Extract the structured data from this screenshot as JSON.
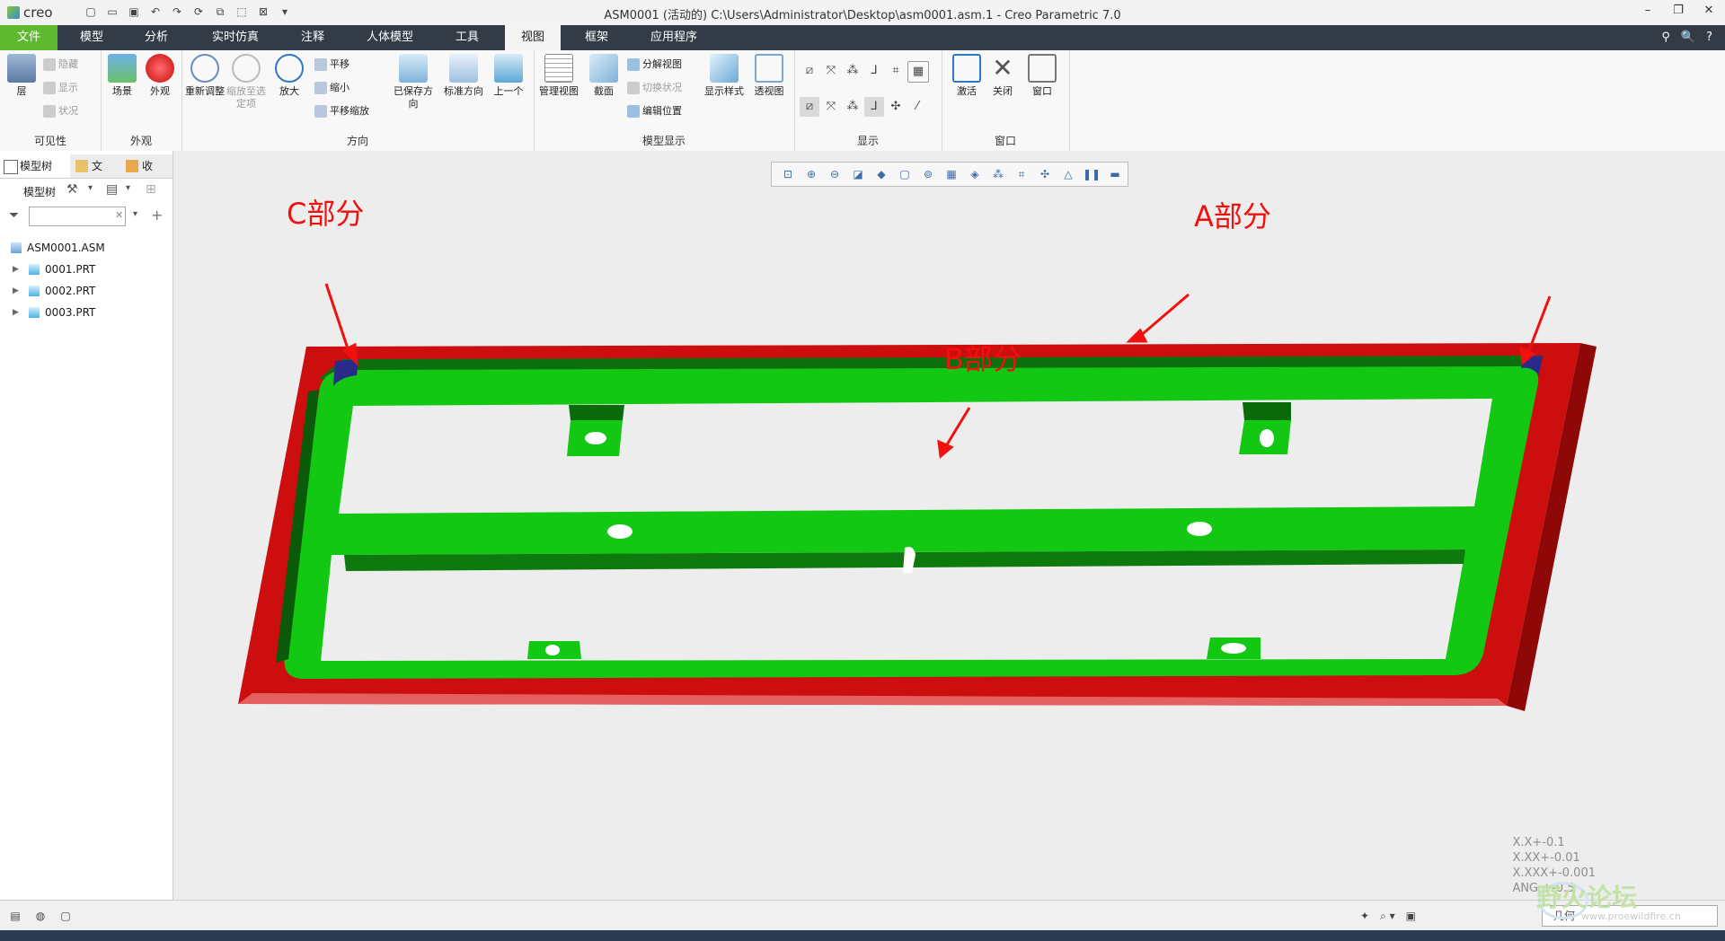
{
  "app": {
    "logo": "creo",
    "title": "ASM0001 (活动的) C:\\Users\\Administrator\\Desktop\\asm0001.asm.1 - Creo Parametric 7.0"
  },
  "quick_access": [
    "new-icon",
    "open-icon",
    "save-icon",
    "undo-icon",
    "redo-icon",
    "regenerate-icon",
    "windows-icon",
    "select-icon",
    "close-window-icon"
  ],
  "tabs": [
    "文件",
    "模型",
    "分析",
    "实时仿真",
    "注释",
    "人体模型",
    "工具",
    "视图",
    "框架",
    "应用程序"
  ],
  "active_tab": "视图",
  "ribbon": {
    "visibility": {
      "label": "可见性",
      "layer": "层",
      "hide": "隐藏",
      "show": "显示",
      "status": "状况"
    },
    "appearance": {
      "label": "外观",
      "scene": "场景",
      "appearance": "外观"
    },
    "orientation": {
      "label": "方向",
      "refit": "重新调整",
      "zoom_to_selected": "缩放至选定项",
      "zoom_in": "放大",
      "pan": "平移",
      "zoom_out": "缩小",
      "pan_zoom": "平移缩放",
      "saved_orient": "已保存方向",
      "standard_orient": "标准方向",
      "previous": "上一个"
    },
    "model_display": {
      "label": "模型显示",
      "manage_views": "管理视图",
      "section": "截面",
      "explode_view": "分解视图",
      "toggle_status": "切换状况",
      "edit_position": "编辑位置",
      "display_style": "显示样式",
      "perspective": "透视图"
    },
    "show": {
      "label": "显示"
    },
    "window": {
      "label": "窗口",
      "activate": "激活",
      "close": "关闭",
      "windows": "窗口"
    }
  },
  "panel": {
    "tabs": [
      "模型树",
      "文",
      "收"
    ],
    "tree_label": "模型树",
    "search_placeholder": "",
    "tree": [
      {
        "name": "ASM0001.ASM",
        "type": "assembly"
      },
      {
        "name": "0001.PRT",
        "type": "part"
      },
      {
        "name": "0002.PRT",
        "type": "part"
      },
      {
        "name": "0003.PRT",
        "type": "part"
      }
    ]
  },
  "viewport": {
    "annotations": {
      "c": "C部分",
      "a": "A部分",
      "b": "B部分"
    },
    "tolerances": [
      "X.X+-0.1",
      "X.XX+-0.01",
      "X.XXX+-0.001",
      "ANG.+-0.5"
    ],
    "colors": {
      "red_frame": "#d01010",
      "green_part": "#12c812",
      "blue_corner": "#2a2a8a",
      "arrow": "#f0100d"
    }
  },
  "status": {
    "filter_value": "几何"
  },
  "watermark": {
    "text": "野火论坛",
    "sub": "www.proewildfire.cn"
  }
}
